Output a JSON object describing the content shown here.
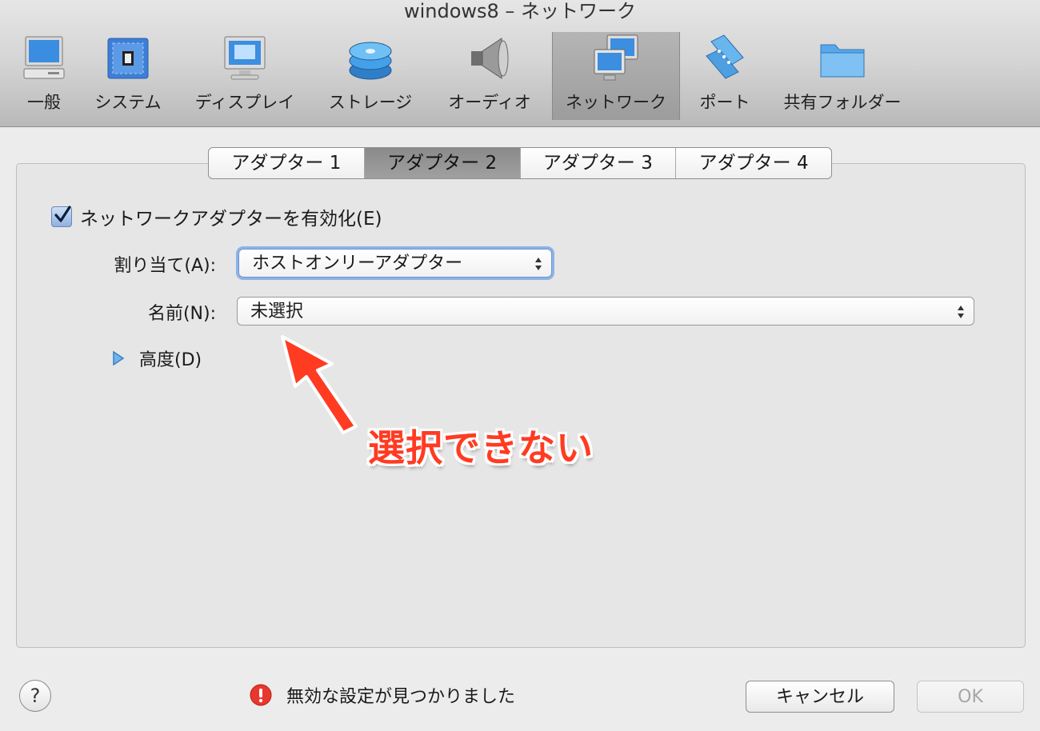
{
  "window": {
    "title": "windows8 – ネットワーク"
  },
  "toolbar": {
    "items": [
      {
        "label": "一般",
        "icon": "computer-icon"
      },
      {
        "label": "システム",
        "icon": "chip-icon"
      },
      {
        "label": "ディスプレイ",
        "icon": "monitor-icon"
      },
      {
        "label": "ストレージ",
        "icon": "disk-stack-icon"
      },
      {
        "label": "オーディオ",
        "icon": "speaker-icon"
      },
      {
        "label": "ネットワーク",
        "icon": "network-icon",
        "selected": true
      },
      {
        "label": "ポート",
        "icon": "port-icon"
      },
      {
        "label": "共有フォルダー",
        "icon": "folder-icon"
      }
    ]
  },
  "tabs": [
    {
      "label": "アダプター 1"
    },
    {
      "label": "アダプター 2",
      "active": true
    },
    {
      "label": "アダプター 3"
    },
    {
      "label": "アダプター 4"
    }
  ],
  "form": {
    "enable_label": "ネットワークアダプターを有効化(E)",
    "enable_checked": true,
    "attach_label": "割り当て(A):",
    "attach_value": "ホストオンリーアダプター",
    "name_label": "名前(N):",
    "name_value": "未選択",
    "advanced_label": "高度(D)"
  },
  "annotation": {
    "text": "選択できない",
    "color": "#ff3b22"
  },
  "footer": {
    "help_label": "?",
    "status_text": "無効な設定が見つかりました",
    "status_icon": "error-icon",
    "cancel_label": "キャンセル",
    "ok_label": "OK"
  },
  "colors": {
    "accent": "#8cb2e8",
    "error": "#e8372c"
  }
}
